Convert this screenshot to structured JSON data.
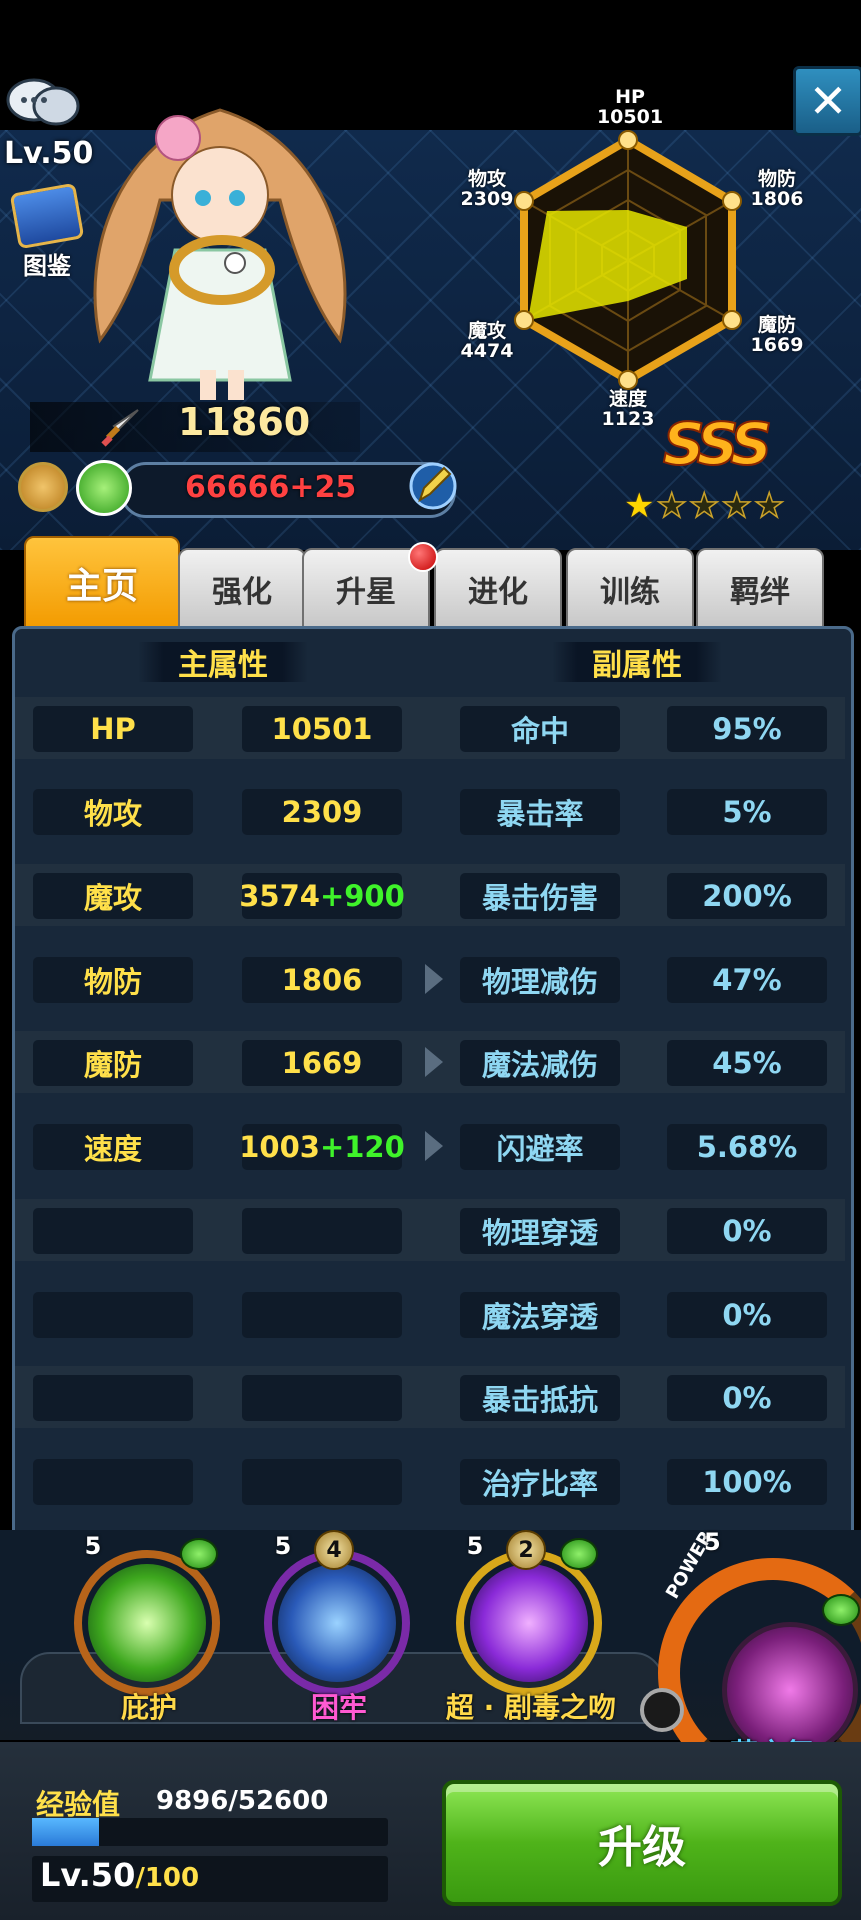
{
  "header": {
    "level": "Lv.50",
    "atlas_label": "图鉴",
    "power": "11860",
    "resource": "66666+25",
    "grade": "SSS",
    "stars_filled": 1,
    "stars_total": 5
  },
  "radar": {
    "hp": {
      "label": "HP",
      "value": "10501"
    },
    "phys_def": {
      "label": "物防",
      "value": "1806"
    },
    "mag_def": {
      "label": "魔防",
      "value": "1669"
    },
    "speed": {
      "label": "速度",
      "value": "1123"
    },
    "mag_atk": {
      "label": "魔攻",
      "value": "4474"
    },
    "phys_atk": {
      "label": "物攻",
      "value": "2309"
    }
  },
  "tabs": [
    "主页",
    "强化",
    "升星",
    "进化",
    "训练",
    "羁绊"
  ],
  "active_tab": 0,
  "sections": {
    "main": "主属性",
    "sub": "副属性"
  },
  "rows": [
    {
      "k1": "HP",
      "v1": "10501",
      "b1": "",
      "k2": "命中",
      "v2": "95%",
      "arrow": false
    },
    {
      "k1": "物攻",
      "v1": "2309",
      "b1": "",
      "k2": "暴击率",
      "v2": "5%",
      "arrow": false
    },
    {
      "k1": "魔攻",
      "v1": "3574",
      "b1": "+900",
      "k2": "暴击伤害",
      "v2": "200%",
      "arrow": false
    },
    {
      "k1": "物防",
      "v1": "1806",
      "b1": "",
      "k2": "物理减伤",
      "v2": "47%",
      "arrow": true
    },
    {
      "k1": "魔防",
      "v1": "1669",
      "b1": "",
      "k2": "魔法减伤",
      "v2": "45%",
      "arrow": true
    },
    {
      "k1": "速度",
      "v1": "1003",
      "b1": "+120",
      "k2": "闪避率",
      "v2": "5.68%",
      "arrow": true
    },
    {
      "k1": "",
      "v1": "",
      "b1": "",
      "k2": "物理穿透",
      "v2": "0%",
      "arrow": false
    },
    {
      "k1": "",
      "v1": "",
      "b1": "",
      "k2": "魔法穿透",
      "v2": "0%",
      "arrow": false
    },
    {
      "k1": "",
      "v1": "",
      "b1": "",
      "k2": "暴击抵抗",
      "v2": "0%",
      "arrow": false
    },
    {
      "k1": "",
      "v1": "",
      "b1": "",
      "k2": "治疗比率",
      "v2": "100%",
      "arrow": false
    }
  ],
  "skills": [
    {
      "name": "庇护",
      "level": "5",
      "badge": ""
    },
    {
      "name": "困牢",
      "level": "5",
      "badge": "4"
    },
    {
      "name": "超 · 剧毒之吻",
      "level": "5",
      "badge": "2"
    }
  ],
  "ultimate": {
    "label": "POWER",
    "name": "花之舞",
    "level": "5"
  },
  "footer": {
    "exp_label": "经验值",
    "exp_value": "9896/52600",
    "exp_fraction": 0.188,
    "level_current": "Lv.50",
    "level_max": "/100",
    "upgrade_label": "升级"
  },
  "colors": {
    "active_tab": "#f7a90f",
    "primary_text": "#ffe04a",
    "secondary_text": "#8fd7f2",
    "bonus": "#3ff32a",
    "radar_fill": "#e6e600"
  }
}
